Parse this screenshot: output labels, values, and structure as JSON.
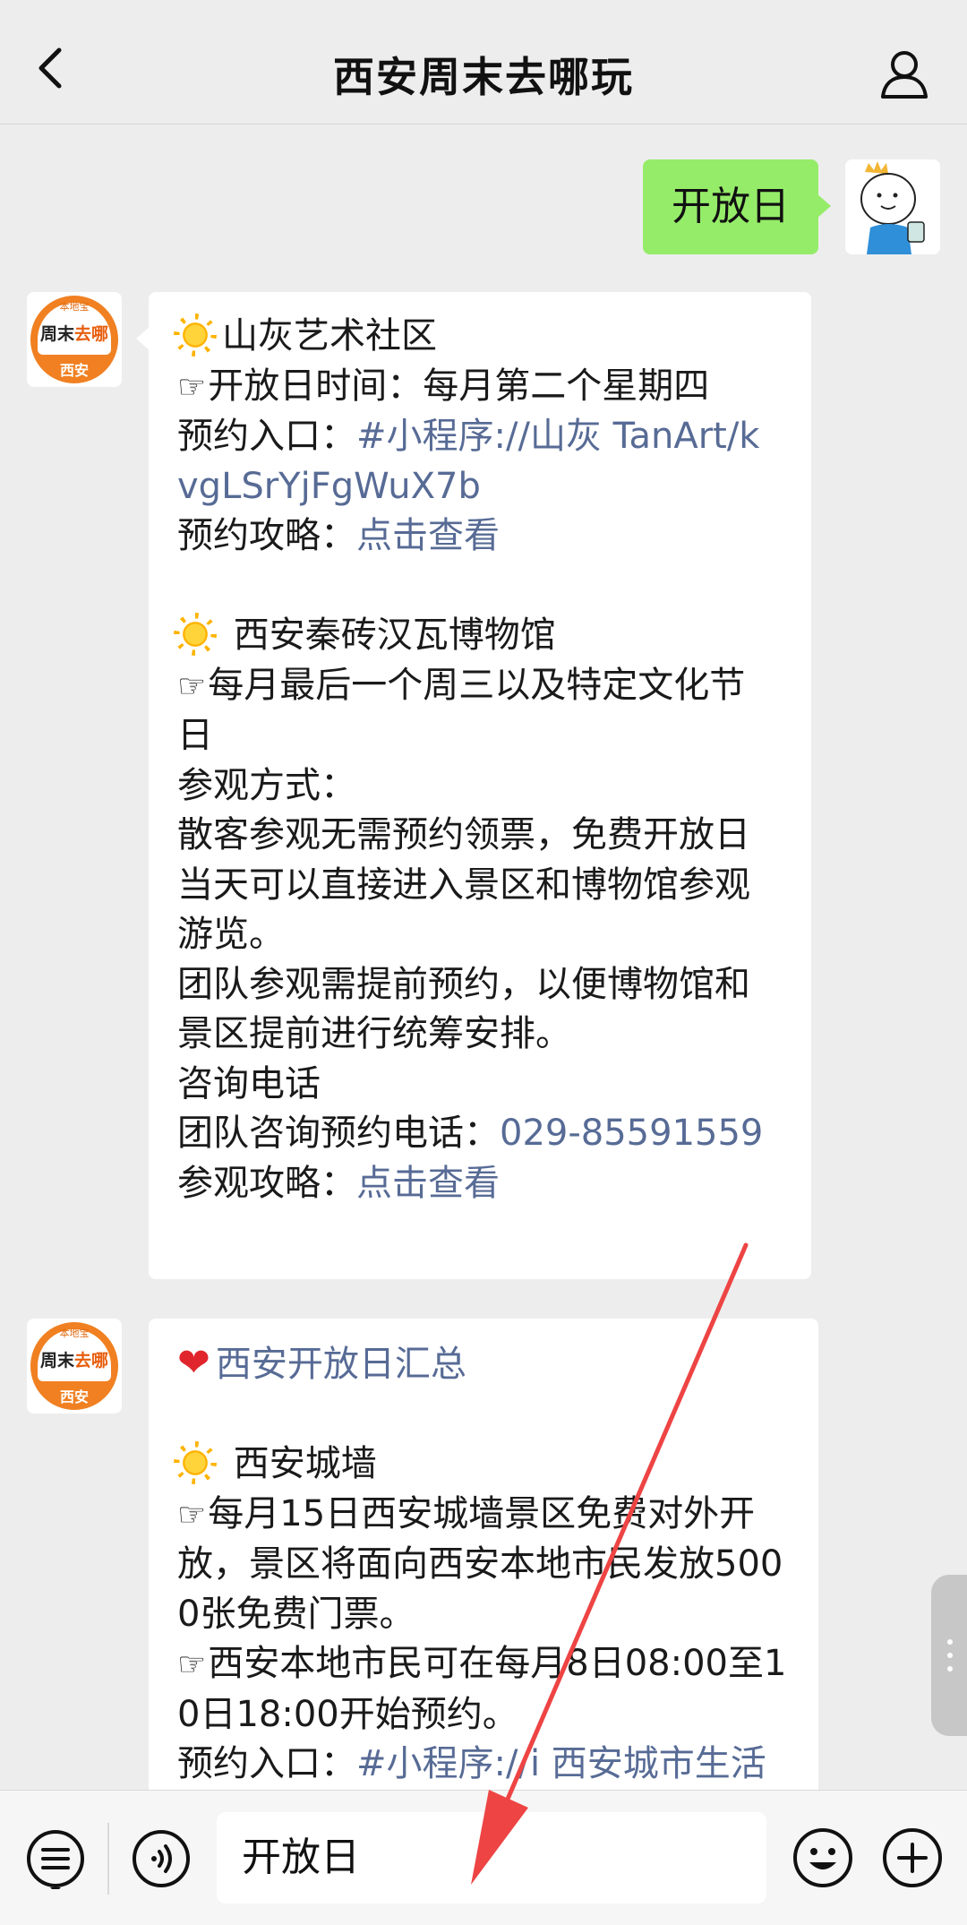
{
  "header": {
    "title": "西安周末去哪玩",
    "back_icon": "chevron-left-icon",
    "profile_icon": "person-icon"
  },
  "outgoing": {
    "text": "开放日"
  },
  "avatar": {
    "top": "本地宝",
    "main_a": "周末",
    "main_b": "去哪",
    "bottom": "西安"
  },
  "message1": {
    "lines": [
      {
        "prefix": "sun",
        "text": "山灰艺术社区"
      },
      {
        "prefix": "hand",
        "text": "开放日时间：每月第二个星期四"
      },
      {
        "label": "预约入口：",
        "link": "#小程序://山灰 TanArt/kvgLSrYjFgWuX7b"
      },
      {
        "label": "预约攻略：",
        "link": "点击查看"
      },
      {
        "prefix": "sun",
        "text": "西安秦砖汉瓦博物馆"
      },
      {
        "prefix": "hand",
        "text": "每月最后一个周三以及特定文化节日"
      },
      {
        "text": "参观方式："
      },
      {
        "text": "散客参观无需预约领票，免费开放日当天可以直接进入景区和博物馆参观游览。"
      },
      {
        "text": "团队参观需提前预约，以便博物馆和景区提前进行统筹安排。"
      },
      {
        "text": "咨询电话"
      },
      {
        "label": "团队咨询预约电话：",
        "link": "029-85591559"
      },
      {
        "label": "参观攻略：",
        "link": "点击查看"
      }
    ]
  },
  "message2": {
    "lines": [
      {
        "prefix": "heart",
        "link": "西安开放日汇总"
      },
      {
        "prefix": "sun",
        "text": "西安城墙"
      },
      {
        "prefix": "hand",
        "text": "每月15日西安城墙景区免费对外开放，景区将面向西安本地市民发放5000张免费门票。"
      },
      {
        "prefix": "hand",
        "text": "西安本地市民可在每月8日08:00至10日18:00开始预约。"
      },
      {
        "label": "预约入口：",
        "link": "#小程序://i 西安城市生活"
      }
    ]
  },
  "input": {
    "value": "开放日"
  },
  "icons": {
    "menu": "list-icon",
    "voice": "voice-icon",
    "emoji": "emoji-icon",
    "plus": "plus-icon"
  },
  "colors": {
    "bubble_out": "#95ec69",
    "link": "#576b95",
    "arrow": "#ee4444"
  }
}
